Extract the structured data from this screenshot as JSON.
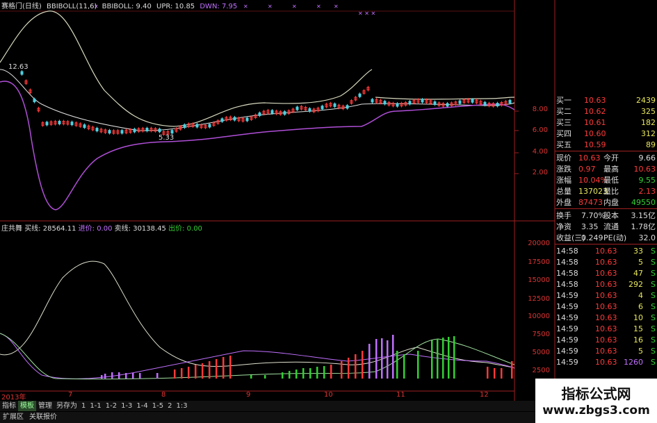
{
  "header": {
    "name": "赛格门(日线)",
    "indicator1": "BBIBOLL(11,6)",
    "indicator2": "BBIBOLL: 9.40",
    "upr": "UPR: 10.85",
    "dwn": "DWN: 7.95"
  },
  "chart_labels": {
    "high_mark": "12.63",
    "low_mark": "5.33",
    "main_y_ticks": [
      "8.00",
      "6.00",
      "4.00",
      "2.00"
    ],
    "sub_y_ticks": [
      "20000",
      "17500",
      "15000",
      "12500",
      "10000",
      "7500",
      "5000",
      "2500"
    ]
  },
  "sub_header": {
    "name": "庄共舞",
    "buy": "买线: 28564.11",
    "entry": "进价: 0.00",
    "sell": "卖线: 30138.45",
    "exit": "出价: 0.00"
  },
  "x_axis": [
    "2013年",
    "7",
    "8",
    "9",
    "10",
    "11",
    "12"
  ],
  "quote_panel": {
    "bids": [
      {
        "label": "买一",
        "price": "10.63",
        "vol": "2439"
      },
      {
        "label": "买二",
        "price": "10.62",
        "vol": "325"
      },
      {
        "label": "买三",
        "price": "10.61",
        "vol": "182"
      },
      {
        "label": "买四",
        "price": "10.60",
        "vol": "312"
      },
      {
        "label": "买五",
        "price": "10.59",
        "vol": "89"
      }
    ],
    "stats": [
      {
        "l1": "现价",
        "v1": "10.63",
        "l2": "今开",
        "v2": "9.66"
      },
      {
        "l1": "涨跌",
        "v1": "0.97",
        "l2": "最高",
        "v2": "10.63"
      },
      {
        "l1": "涨幅",
        "v1": "10.04%",
        "l2": "最低",
        "v2": "9.55"
      },
      {
        "l1": "总量",
        "v1": "137023",
        "l2": "量比",
        "v2": "2.13"
      },
      {
        "l1": "外盘",
        "v1": "87473",
        "l2": "内盘",
        "v2": "49550"
      }
    ],
    "stats2": [
      {
        "l1": "换手",
        "v1": "7.70%",
        "l2": "股本",
        "v2": "3.15亿"
      },
      {
        "l1": "净资",
        "v1": "3.35",
        "l2": "流通",
        "v2": "1.78亿"
      },
      {
        "l1": "收益(三)",
        "v1": "0.249",
        "l2": "PE(动)",
        "v2": "32.0"
      }
    ],
    "ticks": [
      {
        "time": "14:58",
        "price": "10.63",
        "vol": "33",
        "side": "S"
      },
      {
        "time": "14:58",
        "price": "10.63",
        "vol": "5",
        "side": "S"
      },
      {
        "time": "14:58",
        "price": "10.63",
        "vol": "47",
        "side": "S"
      },
      {
        "time": "14:58",
        "price": "10.63",
        "vol": "292",
        "side": "S"
      },
      {
        "time": "14:59",
        "price": "10.63",
        "vol": "4",
        "side": "S"
      },
      {
        "time": "14:59",
        "price": "10.63",
        "vol": "6",
        "side": "S"
      },
      {
        "time": "14:59",
        "price": "10.63",
        "vol": "10",
        "side": "S"
      },
      {
        "time": "14:59",
        "price": "10.63",
        "vol": "15",
        "side": "S"
      },
      {
        "time": "14:59",
        "price": "10.63",
        "vol": "16",
        "side": "S"
      },
      {
        "time": "14:59",
        "price": "10.63",
        "vol": "5",
        "side": "S"
      },
      {
        "time": "14:59",
        "price": "10.63",
        "vol": "1260",
        "side": "S"
      }
    ]
  },
  "tabs": [
    "指标",
    "模板",
    "管理",
    "另存为",
    "1",
    "1-1",
    "1-2",
    "1-3",
    "1-4",
    "1-5",
    "2",
    "1:3"
  ],
  "ext_tabs": [
    "扩展区",
    "关联报价"
  ],
  "logo": {
    "title": "指标公式网",
    "url": "www.zbgs3.com"
  },
  "colors": {
    "up": "#ff3a3a",
    "down": "#33d133",
    "purple": "#b04fd8",
    "upper": "#d9d9c0"
  }
}
